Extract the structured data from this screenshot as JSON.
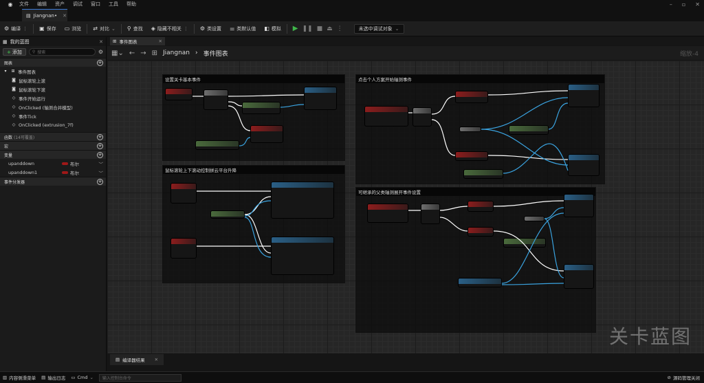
{
  "menu": {
    "items": [
      "文件",
      "编辑",
      "资产",
      "调试",
      "窗口",
      "工具",
      "帮助"
    ]
  },
  "tab": {
    "title": "Jiangnan•"
  },
  "toolbar": {
    "compile": "编译",
    "save": "保存",
    "browse": "浏览",
    "diff": "对比",
    "find": "查找",
    "hide_unrelated": "隐藏不相关",
    "class_settings": "类设置",
    "class_defaults": "类默认值",
    "simulate": "模拟",
    "debug_object": "未选中调试对象"
  },
  "left": {
    "panel_title": "我的蓝图",
    "add": "添加",
    "search_placeholder": "搜索",
    "graphs_section": "图表",
    "event_graph": "事件图表",
    "events": [
      "鼠标滚轮上滚",
      "鼠标滚轮下滚",
      "事件开始运行",
      "OnClicked (轴测合并模型)",
      "事件Tick",
      "OnClicked (extrusion_7f)"
    ],
    "functions_section": "函数",
    "functions_note": "(14可覆盖)",
    "macros_section": "宏",
    "variables_section": "变量",
    "variables": [
      {
        "name": "upanddown",
        "type": "布尔"
      },
      {
        "name": "upanddown1",
        "type": "布尔"
      }
    ],
    "dispatchers_section": "事件分发器"
  },
  "graph": {
    "tab_label": "事件图表",
    "breadcrumb_root": "Jiangnan",
    "breadcrumb_current": "事件图表",
    "zoom": "缩放-4",
    "comments": [
      "设置关卡基本事件",
      "鼠标滚轮上下滚动控制拼云平台升降",
      "点击个人方案开始轴测事件",
      "可继承的父类轴测展开事件设置"
    ],
    "watermark": "关卡蓝图"
  },
  "bottom": {
    "compiler_results": "编译器结果"
  },
  "status": {
    "content_drawer": "内容侧滑菜单",
    "output_log": "输出日志",
    "cmd": "Cmd",
    "cmd_placeholder": "输入控制台命令",
    "source_control": "源码管理关闭"
  },
  "colors": {
    "exec_wire": "#ffffff",
    "object_wire": "#3aa3e0",
    "event_node": "#8c1d1d",
    "function_node": "#2a5f86",
    "pure_node": "#4a6a3c",
    "accent": "#3d7ad6",
    "play": "#3fb64a"
  }
}
